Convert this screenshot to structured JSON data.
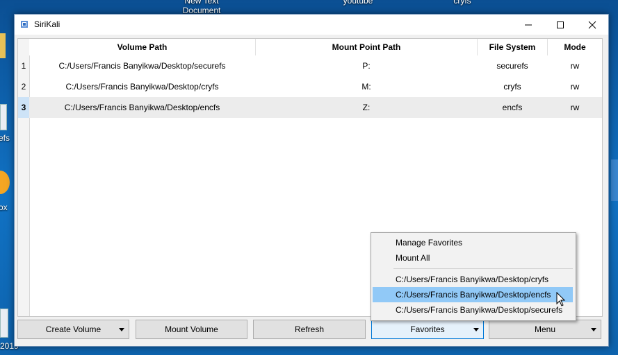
{
  "desktop": {
    "icons": [
      {
        "label": "New Text\nDocument"
      },
      {
        "label": "youtube"
      },
      {
        "label": "cryfs"
      },
      {
        "label": "efs"
      },
      {
        "label": "ox"
      },
      {
        "label": "2019"
      }
    ]
  },
  "window": {
    "title": "SiriKali",
    "controls": {
      "minimize": "minimize",
      "maximize": "maximize",
      "close": "close"
    }
  },
  "table": {
    "columns": [
      "Volume Path",
      "Mount Point Path",
      "File System",
      "Mode"
    ],
    "rows": [
      {
        "num": "1",
        "volume_path": "C:/Users/Francis Banyikwa/Desktop/securefs",
        "mount_point": "P:",
        "file_system": "securefs",
        "mode": "rw"
      },
      {
        "num": "2",
        "volume_path": "C:/Users/Francis Banyikwa/Desktop/cryfs",
        "mount_point": "M:",
        "file_system": "cryfs",
        "mode": "rw"
      },
      {
        "num": "3",
        "volume_path": "C:/Users/Francis Banyikwa/Desktop/encfs",
        "mount_point": "Z:",
        "file_system": "encfs",
        "mode": "rw"
      }
    ],
    "selected_row": 3
  },
  "buttons": {
    "create_volume": "Create Volume",
    "mount_volume": "Mount Volume",
    "refresh": "Refresh",
    "favorites": "Favorites",
    "menu": "Menu"
  },
  "favorites_menu": {
    "manage": "Manage Favorites",
    "mount_all": "Mount All",
    "items": [
      "C:/Users/Francis Banyikwa/Desktop/cryfs",
      "C:/Users/Francis Banyikwa/Desktop/encfs",
      "C:/Users/Francis Banyikwa/Desktop/securefs"
    ],
    "highlighted_index": 1
  },
  "colors": {
    "desktop_bg": "#0d5fa8",
    "highlight": "#91c9f7",
    "selected_row_header": "#cde3f7",
    "active_button_border": "#0078d7"
  }
}
